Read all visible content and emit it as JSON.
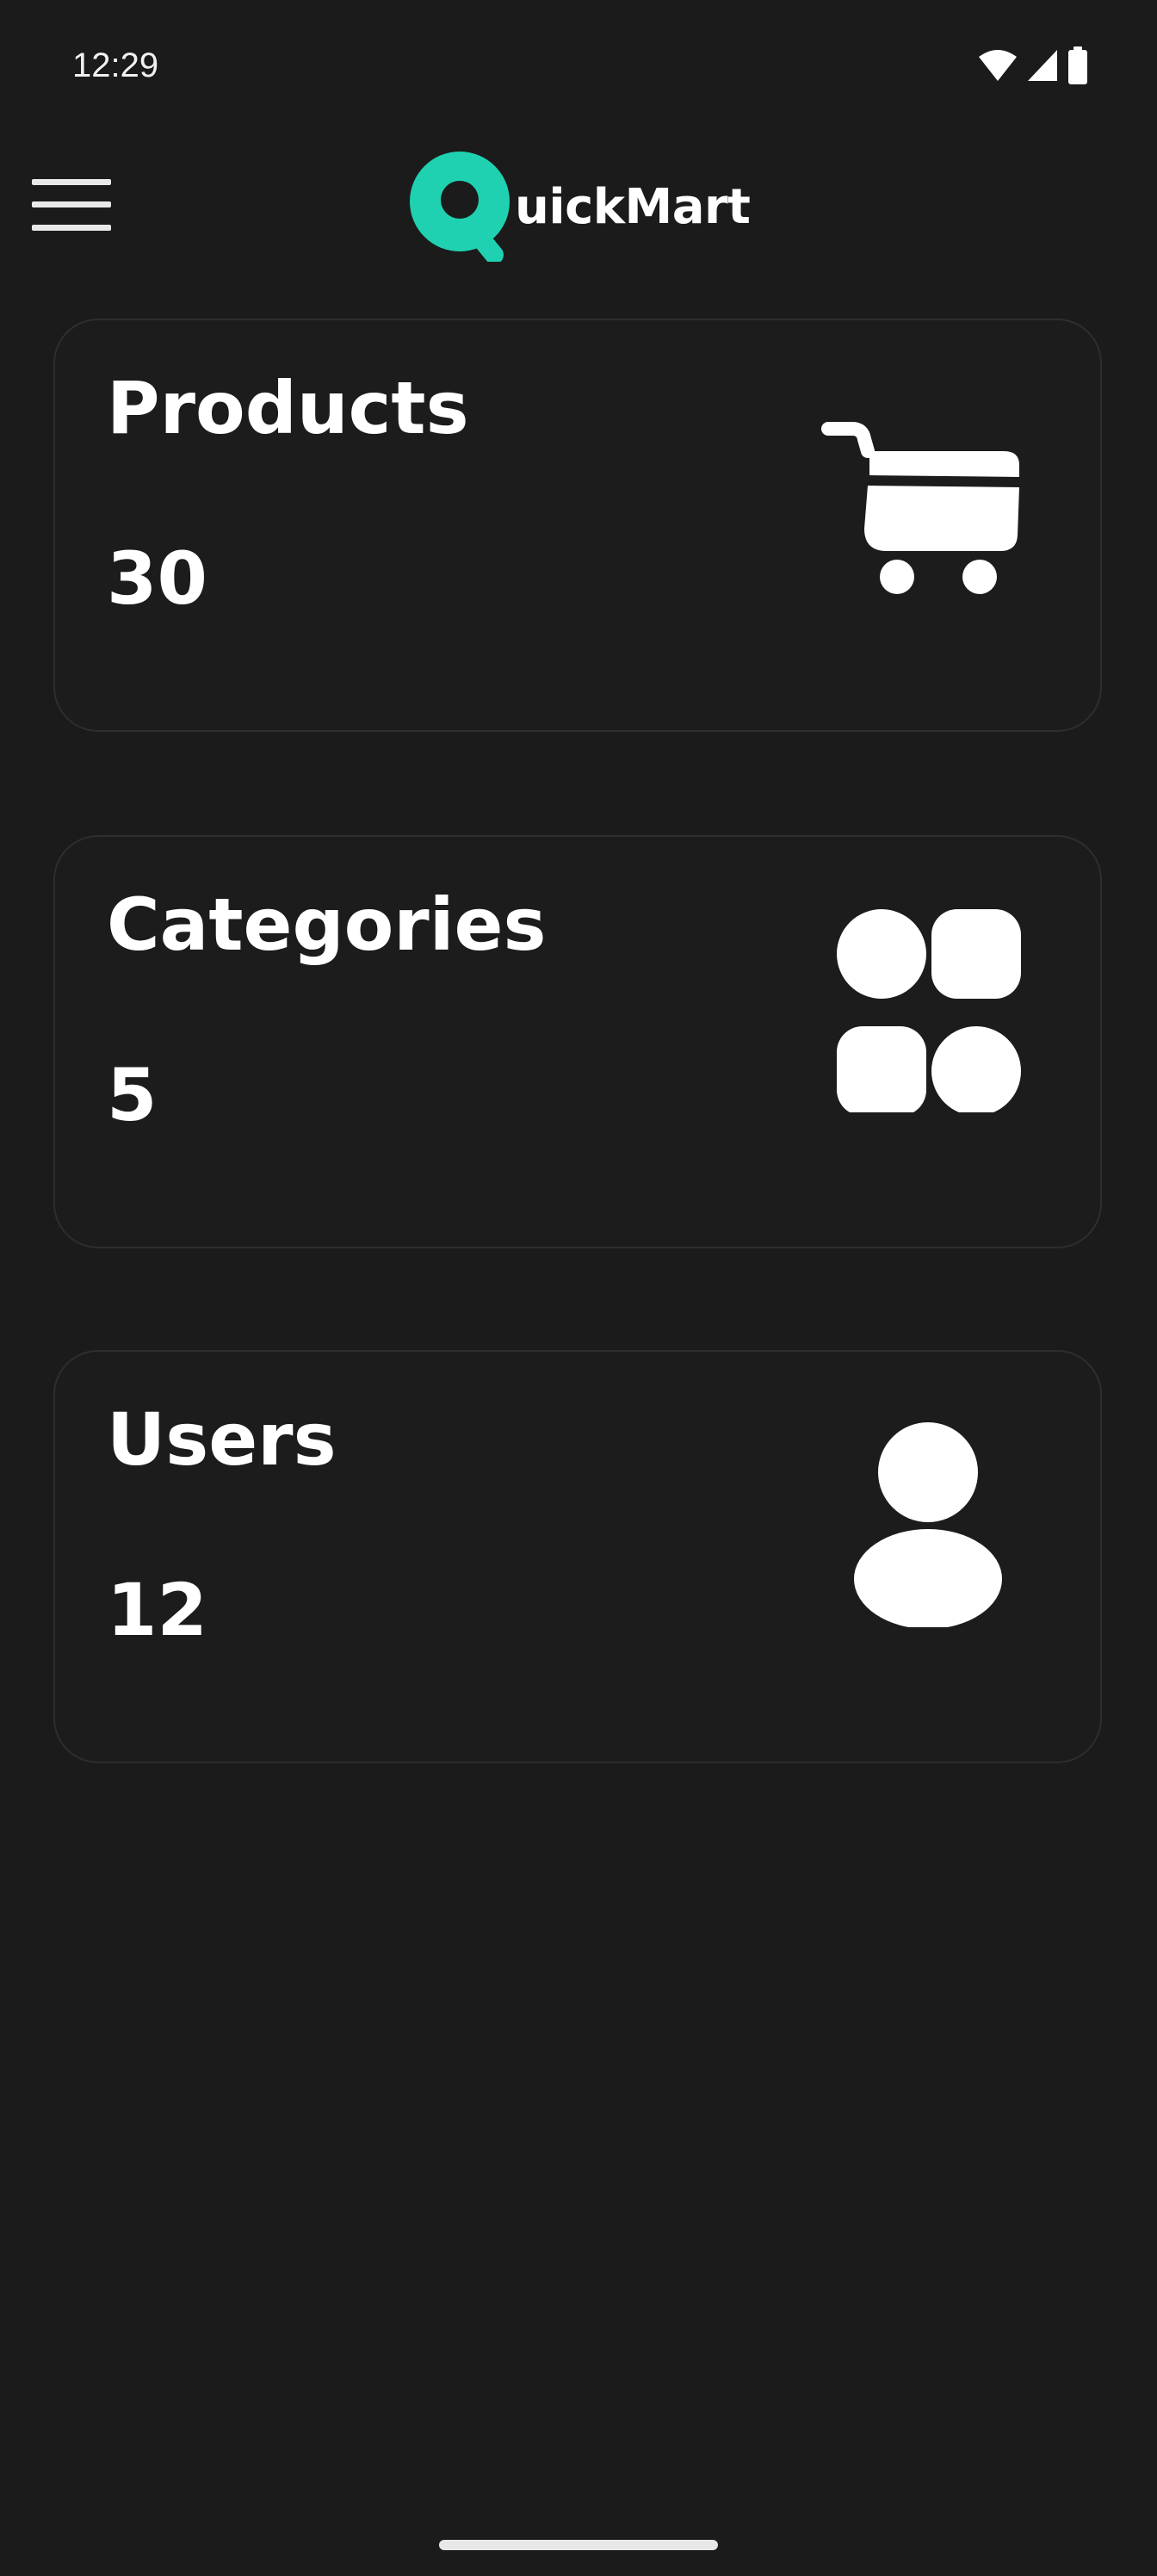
{
  "status_bar": {
    "time": "12:29",
    "icons": [
      "wifi-icon",
      "signal-icon",
      "battery-icon"
    ]
  },
  "app_bar": {
    "menu_icon": "hamburger-menu-icon",
    "logo_letter": "Q",
    "logo_text": "uickMart",
    "accent_color": "#1fd1b0"
  },
  "cards": [
    {
      "title": "Products",
      "count": "30",
      "icon": "shopping-cart-icon"
    },
    {
      "title": "Categories",
      "count": "5",
      "icon": "categories-grid-icon"
    },
    {
      "title": "Users",
      "count": "12",
      "icon": "user-icon"
    }
  ],
  "colors": {
    "background": "#1b1b1b",
    "card_border": "#2e2e2e",
    "text": "#ffffff",
    "accent": "#1fd1b0"
  }
}
